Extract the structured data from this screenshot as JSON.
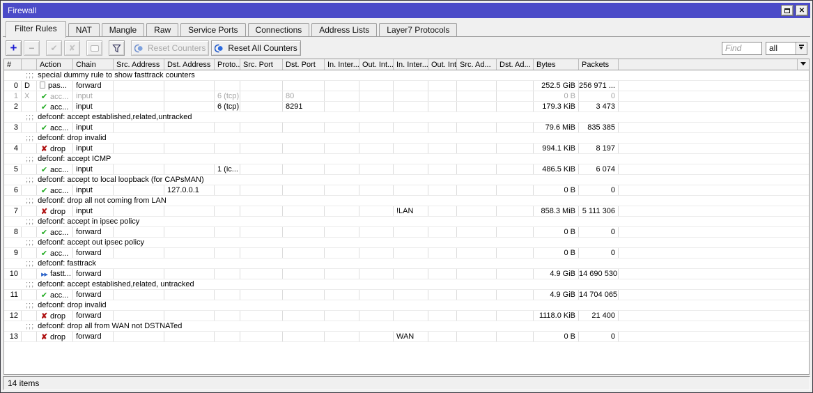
{
  "window": {
    "title": "Firewall"
  },
  "tabs": [
    {
      "label": "Filter Rules",
      "active": true
    },
    {
      "label": "NAT",
      "active": false
    },
    {
      "label": "Mangle",
      "active": false
    },
    {
      "label": "Raw",
      "active": false
    },
    {
      "label": "Service Ports",
      "active": false
    },
    {
      "label": "Connections",
      "active": false
    },
    {
      "label": "Address Lists",
      "active": false
    },
    {
      "label": "Layer7 Protocols",
      "active": false
    }
  ],
  "toolbar": {
    "icon_buttons": [
      {
        "name": "add",
        "enabled": true
      },
      {
        "name": "remove",
        "enabled": false
      },
      {
        "name": "enable",
        "enabled": false,
        "group_start": true
      },
      {
        "name": "disable",
        "enabled": false
      },
      {
        "name": "comment",
        "enabled": false,
        "group_start": true
      },
      {
        "name": "filter",
        "enabled": true,
        "group_start": true
      }
    ],
    "reset_counters_label": "Reset Counters",
    "reset_counters_enabled": false,
    "reset_all_counters_label": "Reset All Counters",
    "reset_all_counters_enabled": true,
    "find_placeholder": "Find",
    "filter_scope_value": "all"
  },
  "table": {
    "columns": [
      {
        "key": "num",
        "label": "#"
      },
      {
        "key": "flags",
        "label": ""
      },
      {
        "key": "action",
        "label": "Action"
      },
      {
        "key": "chain",
        "label": "Chain"
      },
      {
        "key": "src_address",
        "label": "Src. Address"
      },
      {
        "key": "dst_address",
        "label": "Dst. Address"
      },
      {
        "key": "protocol",
        "label": "Proto..."
      },
      {
        "key": "src_port",
        "label": "Src. Port"
      },
      {
        "key": "dst_port",
        "label": "Dst. Port"
      },
      {
        "key": "in_interface",
        "label": "In. Inter..."
      },
      {
        "key": "out_interface",
        "label": "Out. Int..."
      },
      {
        "key": "in_interface_list",
        "label": "In. Inter..."
      },
      {
        "key": "out_interface_list",
        "label": "Out. Int..."
      },
      {
        "key": "src_address_list",
        "label": "Src. Ad..."
      },
      {
        "key": "dst_address_list",
        "label": "Dst. Ad..."
      },
      {
        "key": "bytes",
        "label": "Bytes"
      },
      {
        "key": "packets",
        "label": "Packets"
      }
    ],
    "rows": [
      {
        "type": "comment",
        "prefix": ";;;",
        "text": "special dummy rule to show fasttrack counters"
      },
      {
        "type": "rule",
        "num": "0",
        "flags": "D",
        "action": {
          "icon": "passthrough",
          "label": "pas..."
        },
        "chain": "forward",
        "bytes": "252.5 GiB",
        "packets": "256 971 ..."
      },
      {
        "type": "rule",
        "num": "1",
        "flags": "X",
        "disabled": true,
        "action": {
          "icon": "accept",
          "label": "acc..."
        },
        "chain": "input",
        "protocol": "6 (tcp)",
        "dst_port": "80",
        "bytes": "0 B",
        "packets": "0"
      },
      {
        "type": "rule",
        "num": "2",
        "action": {
          "icon": "accept",
          "label": "acc..."
        },
        "chain": "input",
        "protocol": "6 (tcp)",
        "dst_port": "8291",
        "bytes": "179.3 KiB",
        "packets": "3 473"
      },
      {
        "type": "comment",
        "prefix": ";;;",
        "text": "defconf: accept established,related,untracked"
      },
      {
        "type": "rule",
        "num": "3",
        "action": {
          "icon": "accept",
          "label": "acc..."
        },
        "chain": "input",
        "bytes": "79.6 MiB",
        "packets": "835 385"
      },
      {
        "type": "comment",
        "prefix": ";;;",
        "text": "defconf: drop invalid"
      },
      {
        "type": "rule",
        "num": "4",
        "action": {
          "icon": "drop",
          "label": "drop"
        },
        "chain": "input",
        "bytes": "994.1 KiB",
        "packets": "8 197"
      },
      {
        "type": "comment",
        "prefix": ";;;",
        "text": "defconf: accept ICMP"
      },
      {
        "type": "rule",
        "num": "5",
        "action": {
          "icon": "accept",
          "label": "acc..."
        },
        "chain": "input",
        "protocol": "1 (ic...",
        "bytes": "486.5 KiB",
        "packets": "6 074"
      },
      {
        "type": "comment",
        "prefix": ";;;",
        "text": "defconf: accept to local loopback (for CAPsMAN)"
      },
      {
        "type": "rule",
        "num": "6",
        "action": {
          "icon": "accept",
          "label": "acc..."
        },
        "chain": "input",
        "dst_address": "127.0.0.1",
        "bytes": "0 B",
        "packets": "0"
      },
      {
        "type": "comment",
        "prefix": ";;;",
        "text": "defconf: drop all not coming from LAN"
      },
      {
        "type": "rule",
        "num": "7",
        "action": {
          "icon": "drop",
          "label": "drop"
        },
        "chain": "input",
        "in_interface_list": "!LAN",
        "bytes": "858.3 MiB",
        "packets": "5 111 306"
      },
      {
        "type": "comment",
        "prefix": ";;;",
        "text": "defconf: accept in ipsec policy"
      },
      {
        "type": "rule",
        "num": "8",
        "action": {
          "icon": "accept",
          "label": "acc..."
        },
        "chain": "forward",
        "bytes": "0 B",
        "packets": "0"
      },
      {
        "type": "comment",
        "prefix": ";;;",
        "text": "defconf: accept out ipsec policy"
      },
      {
        "type": "rule",
        "num": "9",
        "action": {
          "icon": "accept",
          "label": "acc..."
        },
        "chain": "forward",
        "bytes": "0 B",
        "packets": "0"
      },
      {
        "type": "comment",
        "prefix": ";;;",
        "text": "defconf: fasttrack"
      },
      {
        "type": "rule",
        "num": "10",
        "action": {
          "icon": "fasttrack",
          "label": "fastt..."
        },
        "chain": "forward",
        "bytes": "4.9 GiB",
        "packets": "14 690 530"
      },
      {
        "type": "comment",
        "prefix": ";;;",
        "text": "defconf: accept established,related, untracked"
      },
      {
        "type": "rule",
        "num": "11",
        "action": {
          "icon": "accept",
          "label": "acc..."
        },
        "chain": "forward",
        "bytes": "4.9 GiB",
        "packets": "14 704 065"
      },
      {
        "type": "comment",
        "prefix": ";;;",
        "text": "defconf: drop invalid"
      },
      {
        "type": "rule",
        "num": "12",
        "action": {
          "icon": "drop",
          "label": "drop"
        },
        "chain": "forward",
        "bytes": "1118.0 KiB",
        "packets": "21 400"
      },
      {
        "type": "comment",
        "prefix": ";;;",
        "text": "defconf: drop all from WAN not DSTNATed"
      },
      {
        "type": "rule",
        "num": "13",
        "action": {
          "icon": "drop",
          "label": "drop"
        },
        "chain": "forward",
        "in_interface_list": "WAN",
        "bytes": "0 B",
        "packets": "0"
      }
    ]
  },
  "status_bar": {
    "items_text": "14 items"
  },
  "colors": {
    "titlebar": "#4b4bc8",
    "accent_blue": "#2a62c8",
    "accept_green": "#1faa1f",
    "drop_red": "#b01414",
    "disabled_text": "#a6a6a6"
  }
}
